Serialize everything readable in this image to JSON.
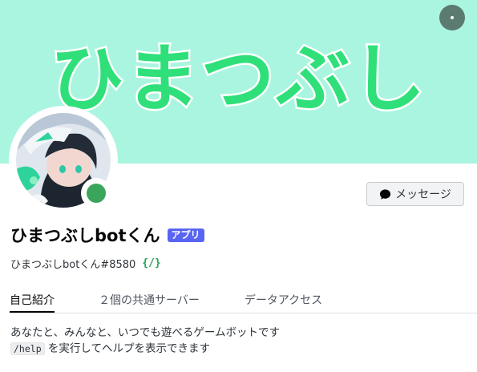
{
  "banner": {
    "text": "ひまつぶし",
    "background": "#aaf5df",
    "text_color": "#2fe07a"
  },
  "more_button_icon": "more-horizontal-icon",
  "status": {
    "color": "#3ba55c"
  },
  "message_button": {
    "label": "メッセージ",
    "icon": "chat-bubble-icon"
  },
  "profile": {
    "display_name": "ひまつぶしbotくん",
    "app_badge": "アプリ",
    "username": "ひまつぶしbotくん#8580",
    "dev_badge": "{/}"
  },
  "tabs": [
    {
      "label": "自己紹介",
      "active": true
    },
    {
      "label": "２個の共通サーバー",
      "active": false
    },
    {
      "label": "データアクセス",
      "active": false
    }
  ],
  "about": {
    "line1": "あなたと、みんなと、いつでも遊べるゲームボットです",
    "command": "/help",
    "line2_rest": " を実行してヘルプを表示できます"
  }
}
